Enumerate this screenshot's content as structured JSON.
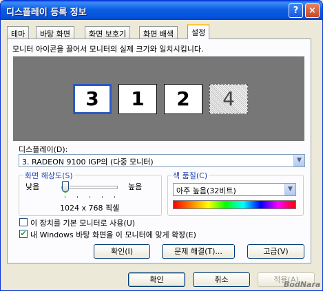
{
  "window": {
    "title": "디스플레이 등록 정보",
    "help_label": "?",
    "close_label": "×"
  },
  "tabs": [
    {
      "label": "테마"
    },
    {
      "label": "바탕 화면"
    },
    {
      "label": "화면 보호기"
    },
    {
      "label": "화면 배색"
    },
    {
      "label": "설정",
      "active": true
    }
  ],
  "settings": {
    "info_text": "모니터 아이콘을 끌어서 모니터의 실제 크기와 일치시킵니다.",
    "monitors": [
      "3",
      "1",
      "2",
      "4"
    ],
    "display_label": "디스플레이(D):",
    "display_value": "3.  RADEON 9100 IGP의 (다중 모니터)",
    "resolution": {
      "title": "화면 해상도(S)",
      "low_label": "낮음",
      "high_label": "높음",
      "value_text": "1024 x 768 픽셀",
      "slider_position": 0.1
    },
    "color_quality": {
      "title": "색 품질(C)",
      "value": "아주 높음(32비트)"
    },
    "checkbox_primary": {
      "label": "이 장치를 기본 모니터로 사용(U)",
      "checked": false
    },
    "checkbox_extend": {
      "label": "내 Windows 바탕 화면을 이 모니터에 맞게 확장(E)",
      "checked": true
    },
    "buttons": {
      "identify": "확인(I)",
      "troubleshoot": "문제 해결(T)...",
      "advanced": "고급(V)"
    }
  },
  "dialog_buttons": {
    "ok": "확인",
    "cancel": "취소",
    "apply": "적용(A)"
  },
  "watermark": "BodNara",
  "colors": {
    "titlebar": "#0a5ae8",
    "preview_bg": "#777777",
    "selected_monitor_border": "#2a57c6",
    "group_title": "#1f3fa8"
  }
}
